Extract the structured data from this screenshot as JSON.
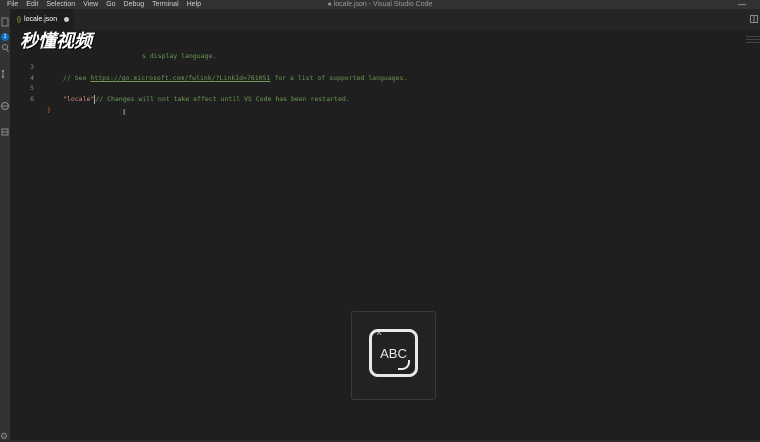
{
  "menu": [
    "File",
    "Edit",
    "Selection",
    "View",
    "Go",
    "Debug",
    "Terminal",
    "Help"
  ],
  "window_title": "● locale.json - Visual Studio Code",
  "window_control": "—",
  "tab": {
    "icon": "{}",
    "label": "locale.json"
  },
  "activity_badge": "1",
  "editor_lines": [
    {
      "num": "3",
      "text": "// See https://go.microsoft.com/fwlink/?LinkId=761051 for a list of supported languages."
    },
    {
      "num": "4",
      "text": ""
    },
    {
      "num": "5",
      "key": "\"locale\"",
      "comment": "// Changes will not take effect until VS Code has been restarted."
    },
    {
      "num": "6",
      "text": "}"
    }
  ],
  "line2_fragment": "s display language.",
  "line3": {
    "prefix": "// See ",
    "url": "https://go.microsoft.com/fwlink/?LinkId=761051",
    "suffix": " for a list of supported languages."
  },
  "line5": {
    "key": "\"locale\"",
    "comment": "// Changes will not take effect until VS Code has been restarted."
  },
  "line6": "}",
  "watermark": "秒懂视频",
  "osd": {
    "label": "ABC",
    "icon": "keyboard-input-icon"
  },
  "colors": {
    "editor_bg": "#1f1f1f",
    "comment": "#6a9955",
    "string": "#ce9178",
    "accent": "#0e70c0"
  }
}
